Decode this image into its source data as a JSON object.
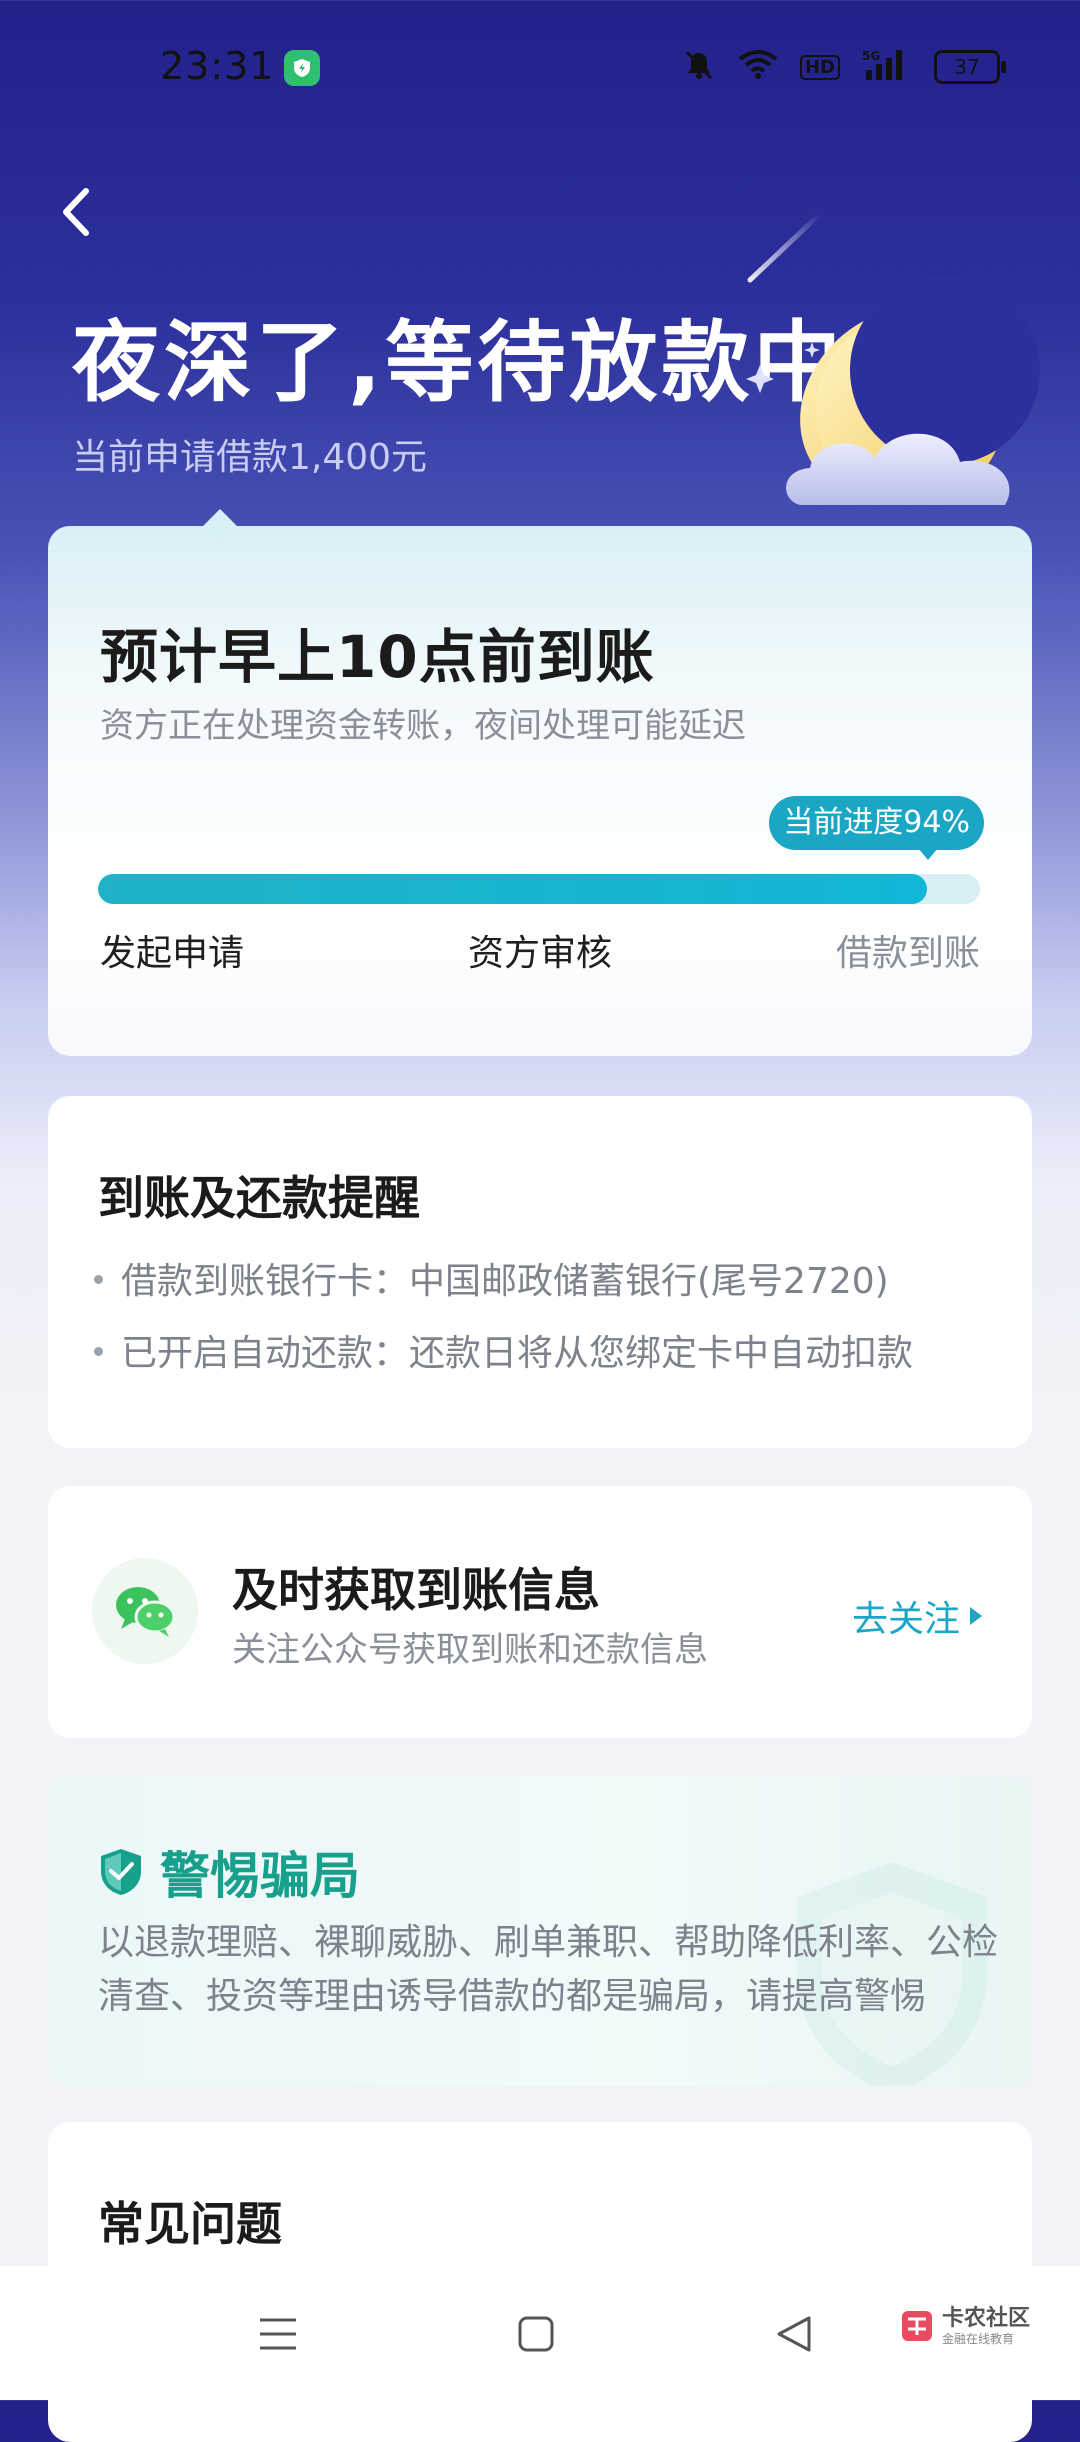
{
  "status_bar": {
    "time": "23:31",
    "battery": "37",
    "network_label": "5G",
    "hd_label": "HD"
  },
  "header": {
    "title": "夜深了,等待放款中",
    "subtitle": "当前申请借款1,400元"
  },
  "progress_card": {
    "title": "预计早上10点前到账",
    "description": "资方正在处理资金转账，夜间处理可能延迟",
    "progress_label": "当前进度94%",
    "progress_percent": 94,
    "steps": [
      "发起申请",
      "资方审核",
      "借款到账"
    ]
  },
  "reminder_card": {
    "title": "到账及还款提醒",
    "lines": [
      "借款到账银行卡：中国邮政储蓄银行(尾号2720)",
      "已开启自动还款：还款日将从您绑定卡中自动扣款"
    ]
  },
  "wechat_card": {
    "title": "及时获取到账信息",
    "description": "关注公众号获取到账和还款信息",
    "action_label": "去关注"
  },
  "fraud_card": {
    "title": "警惕骗局",
    "text": "以退款理赔、裸聊威胁、刷单兼职、帮助降低利率、公检清查、投资等理由诱导借款的都是骗局，请提高警惕"
  },
  "faq_card": {
    "title": "常见问题"
  },
  "watermark": {
    "main": "卡农社区",
    "sub": "金融在线教育"
  },
  "colors": {
    "accent": "#1aa6c4",
    "fraud_green": "#17a08c",
    "header_bg": "#23218a"
  }
}
